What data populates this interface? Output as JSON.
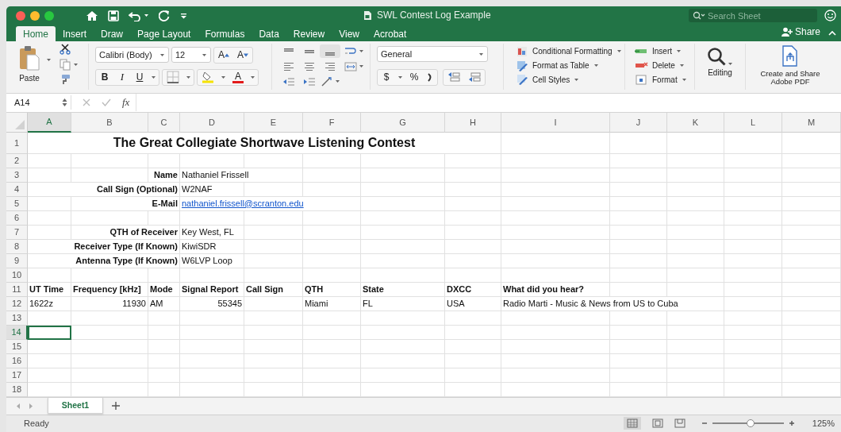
{
  "window": {
    "title": "SWL Contest Log Example",
    "search_placeholder": "Search Sheet"
  },
  "menu_tabs": [
    {
      "label": "Home",
      "selected": true
    },
    {
      "label": "Insert",
      "selected": false
    },
    {
      "label": "Draw",
      "selected": false
    },
    {
      "label": "Page Layout",
      "selected": false
    },
    {
      "label": "Formulas",
      "selected": false
    },
    {
      "label": "Data",
      "selected": false
    },
    {
      "label": "Review",
      "selected": false
    },
    {
      "label": "View",
      "selected": false
    },
    {
      "label": "Acrobat",
      "selected": false
    }
  ],
  "share": "Share",
  "ribbon": {
    "paste": "Paste",
    "font_name": "Calibri (Body)",
    "font_size": "12",
    "grow_font": "A",
    "shrink_font": "A",
    "style_buttons": [
      "B",
      "I",
      "U"
    ],
    "font_color": "A",
    "number_format": "General",
    "currency": "$",
    "percent": "%",
    "styles": [
      "Conditional Formatting",
      "Format as Table",
      "Cell Styles"
    ],
    "cell_actions": [
      "Insert",
      "Delete",
      "Format"
    ],
    "editing": "Editing",
    "pdf": "Create and Share Adobe PDF"
  },
  "formula_bar": {
    "name_box": "A14",
    "fx": "fx"
  },
  "columns": [
    {
      "label": "A",
      "selected": true
    },
    {
      "label": "B",
      "selected": false
    },
    {
      "label": "C",
      "selected": false
    },
    {
      "label": "D",
      "selected": false
    },
    {
      "label": "E",
      "selected": false
    },
    {
      "label": "F",
      "selected": false
    },
    {
      "label": "G",
      "selected": false
    },
    {
      "label": "H",
      "selected": false
    },
    {
      "label": "I",
      "selected": false
    },
    {
      "label": "J",
      "selected": false
    },
    {
      "label": "K",
      "selected": false
    },
    {
      "label": "L",
      "selected": false
    },
    {
      "label": "M",
      "selected": false
    }
  ],
  "rows": [
    {
      "number": "1",
      "selected": false,
      "cells": [
        {
          "kind": "title",
          "text": "The Great Collegiate Shortwave Listening Contest"
        },
        {
          "kind": "blank"
        },
        {
          "kind": "blank"
        },
        {
          "kind": "blank"
        },
        {
          "kind": "blank"
        },
        {
          "kind": "blank"
        }
      ]
    },
    {
      "number": "2",
      "selected": false,
      "cells": [
        {
          "kind": "blank"
        },
        {
          "kind": "blank"
        },
        {
          "kind": "blank"
        },
        {
          "kind": "blank"
        },
        {
          "kind": "blank"
        },
        {
          "kind": "blank"
        },
        {
          "kind": "blank"
        },
        {
          "kind": "blank"
        },
        {
          "kind": "blank"
        },
        {
          "kind": "blank"
        },
        {
          "kind": "blank"
        },
        {
          "kind": "blank"
        },
        {
          "kind": "blank"
        }
      ]
    },
    {
      "number": "3",
      "selected": false,
      "cells": [
        {
          "kind": "blank"
        },
        {
          "kind": "blank"
        },
        {
          "kind": "label",
          "text": "Name"
        },
        {
          "kind": "text",
          "text": "Nathaniel Frissell"
        },
        {
          "kind": "blank"
        },
        {
          "kind": "blank"
        },
        {
          "kind": "blank"
        },
        {
          "kind": "blank"
        },
        {
          "kind": "blank"
        },
        {
          "kind": "blank"
        },
        {
          "kind": "blank"
        },
        {
          "kind": "blank"
        },
        {
          "kind": "blank"
        }
      ]
    },
    {
      "number": "4",
      "selected": false,
      "cells": [
        {
          "kind": "blank"
        },
        {
          "kind": "blank"
        },
        {
          "kind": "label",
          "text": "Call Sign (Optional)"
        },
        {
          "kind": "text",
          "text": "W2NAF"
        },
        {
          "kind": "blank"
        },
        {
          "kind": "blank"
        },
        {
          "kind": "blank"
        },
        {
          "kind": "blank"
        },
        {
          "kind": "blank"
        },
        {
          "kind": "blank"
        },
        {
          "kind": "blank"
        },
        {
          "kind": "blank"
        },
        {
          "kind": "blank"
        }
      ]
    },
    {
      "number": "5",
      "selected": false,
      "cells": [
        {
          "kind": "blank"
        },
        {
          "kind": "blank"
        },
        {
          "kind": "label",
          "text": "E-Mail"
        },
        {
          "kind": "link",
          "text": "nathaniel.frissell@scranton.edu"
        },
        {
          "kind": "blank"
        },
        {
          "kind": "blank"
        },
        {
          "kind": "blank"
        },
        {
          "kind": "blank"
        },
        {
          "kind": "blank"
        },
        {
          "kind": "blank"
        },
        {
          "kind": "blank"
        },
        {
          "kind": "blank"
        },
        {
          "kind": "blank"
        }
      ]
    },
    {
      "number": "6",
      "selected": false,
      "cells": [
        {
          "kind": "blank"
        },
        {
          "kind": "blank"
        },
        {
          "kind": "blank"
        },
        {
          "kind": "blank"
        },
        {
          "kind": "blank"
        },
        {
          "kind": "blank"
        },
        {
          "kind": "blank"
        },
        {
          "kind": "blank"
        },
        {
          "kind": "blank"
        },
        {
          "kind": "blank"
        },
        {
          "kind": "blank"
        },
        {
          "kind": "blank"
        },
        {
          "kind": "blank"
        }
      ]
    },
    {
      "number": "7",
      "selected": false,
      "cells": [
        {
          "kind": "blank"
        },
        {
          "kind": "blank"
        },
        {
          "kind": "label",
          "text": "QTH of Receiver"
        },
        {
          "kind": "text",
          "text": "Key West, FL"
        },
        {
          "kind": "blank"
        },
        {
          "kind": "blank"
        },
        {
          "kind": "blank"
        },
        {
          "kind": "blank"
        },
        {
          "kind": "blank"
        },
        {
          "kind": "blank"
        },
        {
          "kind": "blank"
        },
        {
          "kind": "blank"
        },
        {
          "kind": "blank"
        }
      ]
    },
    {
      "number": "8",
      "selected": false,
      "cells": [
        {
          "kind": "blank"
        },
        {
          "kind": "blank"
        },
        {
          "kind": "label",
          "text": "Receiver Type (If Known)"
        },
        {
          "kind": "text",
          "text": "KiwiSDR"
        },
        {
          "kind": "blank"
        },
        {
          "kind": "blank"
        },
        {
          "kind": "blank"
        },
        {
          "kind": "blank"
        },
        {
          "kind": "blank"
        },
        {
          "kind": "blank"
        },
        {
          "kind": "blank"
        },
        {
          "kind": "blank"
        },
        {
          "kind": "blank"
        }
      ]
    },
    {
      "number": "9",
      "selected": false,
      "cells": [
        {
          "kind": "blank"
        },
        {
          "kind": "blank"
        },
        {
          "kind": "label",
          "text": "Antenna Type (If Known)"
        },
        {
          "kind": "text",
          "text": "W6LVP Loop"
        },
        {
          "kind": "blank"
        },
        {
          "kind": "blank"
        },
        {
          "kind": "blank"
        },
        {
          "kind": "blank"
        },
        {
          "kind": "blank"
        },
        {
          "kind": "blank"
        },
        {
          "kind": "blank"
        },
        {
          "kind": "blank"
        },
        {
          "kind": "blank"
        }
      ]
    },
    {
      "number": "10",
      "selected": false,
      "cells": [
        {
          "kind": "blank"
        },
        {
          "kind": "blank"
        },
        {
          "kind": "blank"
        },
        {
          "kind": "blank"
        },
        {
          "kind": "blank"
        },
        {
          "kind": "blank"
        },
        {
          "kind": "blank"
        },
        {
          "kind": "blank"
        },
        {
          "kind": "blank"
        },
        {
          "kind": "blank"
        },
        {
          "kind": "blank"
        },
        {
          "kind": "blank"
        },
        {
          "kind": "blank"
        }
      ]
    },
    {
      "number": "11",
      "selected": false,
      "cells": [
        {
          "kind": "header",
          "text": "UT Time"
        },
        {
          "kind": "header",
          "text": "Frequency [kHz]"
        },
        {
          "kind": "header",
          "text": "Mode"
        },
        {
          "kind": "header",
          "text": "Signal Report"
        },
        {
          "kind": "header",
          "text": "Call Sign"
        },
        {
          "kind": "header",
          "text": "QTH"
        },
        {
          "kind": "header",
          "text": "State"
        },
        {
          "kind": "header",
          "text": "DXCC"
        },
        {
          "kind": "header",
          "text": "What did you hear?"
        },
        {
          "kind": "blank"
        },
        {
          "kind": "blank"
        },
        {
          "kind": "blank"
        },
        {
          "kind": "blank"
        }
      ]
    },
    {
      "number": "12",
      "selected": false,
      "cells": [
        {
          "kind": "text",
          "text": "1622z"
        },
        {
          "kind": "number",
          "text": "11930"
        },
        {
          "kind": "text",
          "text": "AM"
        },
        {
          "kind": "number",
          "text": "55345"
        },
        {
          "kind": "blank"
        },
        {
          "kind": "text",
          "text": "Miami"
        },
        {
          "kind": "text",
          "text": "FL"
        },
        {
          "kind": "text",
          "text": "USA"
        },
        {
          "kind": "text",
          "text": "Radio Marti - Music & News from US to Cuba"
        },
        {
          "kind": "blank"
        },
        {
          "kind": "blank"
        },
        {
          "kind": "blank"
        },
        {
          "kind": "blank"
        }
      ]
    },
    {
      "number": "13",
      "selected": false,
      "cells": [
        {
          "kind": "blank"
        },
        {
          "kind": "blank"
        },
        {
          "kind": "blank"
        },
        {
          "kind": "blank"
        },
        {
          "kind": "blank"
        },
        {
          "kind": "blank"
        },
        {
          "kind": "blank"
        },
        {
          "kind": "blank"
        },
        {
          "kind": "blank"
        },
        {
          "kind": "blank"
        },
        {
          "kind": "blank"
        },
        {
          "kind": "blank"
        },
        {
          "kind": "blank"
        }
      ]
    },
    {
      "number": "14",
      "selected": true,
      "cells": [
        {
          "kind": "blank"
        },
        {
          "kind": "blank"
        },
        {
          "kind": "blank"
        },
        {
          "kind": "blank"
        },
        {
          "kind": "blank"
        },
        {
          "kind": "blank"
        },
        {
          "kind": "blank"
        },
        {
          "kind": "blank"
        },
        {
          "kind": "blank"
        },
        {
          "kind": "blank"
        },
        {
          "kind": "blank"
        },
        {
          "kind": "blank"
        },
        {
          "kind": "blank"
        }
      ]
    },
    {
      "number": "15",
      "selected": false,
      "cells": [
        {
          "kind": "blank"
        },
        {
          "kind": "blank"
        },
        {
          "kind": "blank"
        },
        {
          "kind": "blank"
        },
        {
          "kind": "blank"
        },
        {
          "kind": "blank"
        },
        {
          "kind": "blank"
        },
        {
          "kind": "blank"
        },
        {
          "kind": "blank"
        },
        {
          "kind": "blank"
        },
        {
          "kind": "blank"
        },
        {
          "kind": "blank"
        },
        {
          "kind": "blank"
        }
      ]
    },
    {
      "number": "16",
      "selected": false,
      "cells": [
        {
          "kind": "blank"
        },
        {
          "kind": "blank"
        },
        {
          "kind": "blank"
        },
        {
          "kind": "blank"
        },
        {
          "kind": "blank"
        },
        {
          "kind": "blank"
        },
        {
          "kind": "blank"
        },
        {
          "kind": "blank"
        },
        {
          "kind": "blank"
        },
        {
          "kind": "blank"
        },
        {
          "kind": "blank"
        },
        {
          "kind": "blank"
        },
        {
          "kind": "blank"
        }
      ]
    },
    {
      "number": "17",
      "selected": false,
      "cells": [
        {
          "kind": "blank"
        },
        {
          "kind": "blank"
        },
        {
          "kind": "blank"
        },
        {
          "kind": "blank"
        },
        {
          "kind": "blank"
        },
        {
          "kind": "blank"
        },
        {
          "kind": "blank"
        },
        {
          "kind": "blank"
        },
        {
          "kind": "blank"
        },
        {
          "kind": "blank"
        },
        {
          "kind": "blank"
        },
        {
          "kind": "blank"
        },
        {
          "kind": "blank"
        }
      ]
    },
    {
      "number": "18",
      "selected": false,
      "cells": [
        {
          "kind": "blank"
        },
        {
          "kind": "blank"
        },
        {
          "kind": "blank"
        },
        {
          "kind": "blank"
        },
        {
          "kind": "blank"
        },
        {
          "kind": "blank"
        },
        {
          "kind": "blank"
        },
        {
          "kind": "blank"
        },
        {
          "kind": "blank"
        },
        {
          "kind": "blank"
        },
        {
          "kind": "blank"
        },
        {
          "kind": "blank"
        },
        {
          "kind": "blank"
        }
      ]
    }
  ],
  "sheet_tabs": [
    {
      "label": "Sheet1",
      "selected": true
    }
  ],
  "status_bar": {
    "status": "Ready",
    "zoom_slider": {
      "level": 0.53
    },
    "zoom": "125%"
  }
}
